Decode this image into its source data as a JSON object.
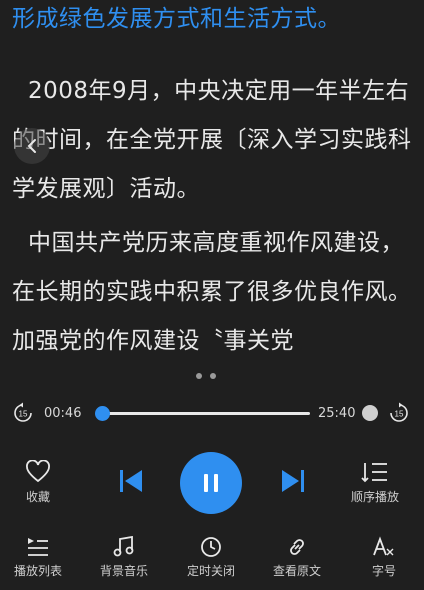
{
  "article": {
    "line_highlight": "形成绿色发展方式和生活方式。",
    "para2": "2008年9月，中央决定用一年半左右的时间，在全党开展〔深入学习实践科学发展观〕活动。",
    "para3": "中国共产党历来高度重视作风建设，在长期的实践中积累了很多优良作风。加强党的作风建设〝事关党"
  },
  "player": {
    "elapsed": "00:46",
    "duration": "25:40",
    "progress": 0.03,
    "skip_back_label": "15",
    "skip_fwd_label": "15"
  },
  "controls": {
    "favorite": "收藏",
    "order": "顺序播放"
  },
  "bottom_nav": [
    {
      "label": "播放列表",
      "icon": "playlist-icon"
    },
    {
      "label": "背景音乐",
      "icon": "music-note-icon"
    },
    {
      "label": "定时关闭",
      "icon": "clock-icon"
    },
    {
      "label": "查看原文",
      "icon": "link-icon"
    },
    {
      "label": "字号",
      "icon": "font-size-icon"
    }
  ],
  "colors": {
    "accent": "#2f8ff0",
    "background": "#1f1f1f"
  }
}
